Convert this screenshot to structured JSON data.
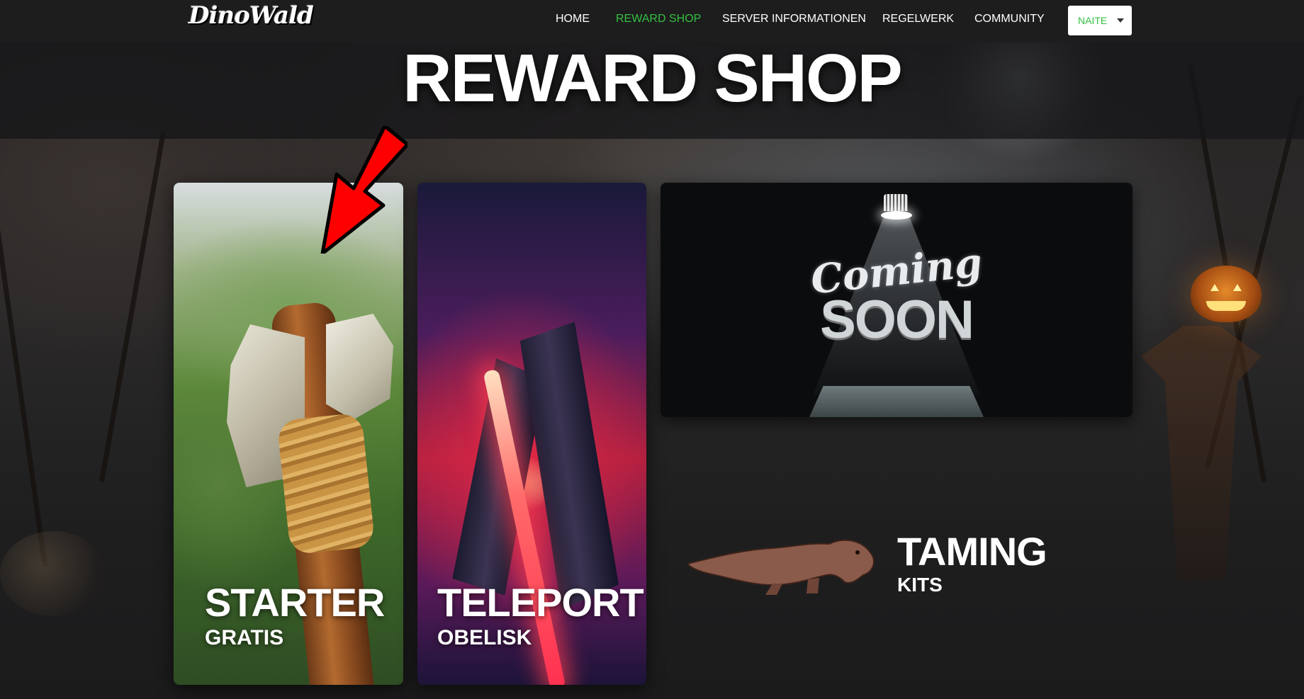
{
  "nav": {
    "logo": "DinoWald",
    "items": [
      {
        "label": "HOME",
        "active": false
      },
      {
        "label": "REWARD SHOP",
        "active": true
      },
      {
        "label": "SERVER INFORMATIONEN",
        "active": false
      },
      {
        "label": "REGELWERK",
        "active": false
      },
      {
        "label": "COMMUNITY",
        "active": false
      }
    ],
    "user": "NAITE",
    "active_color": "#34c141"
  },
  "page": {
    "title": "REWARD SHOP"
  },
  "cards": {
    "starter": {
      "title": "STARTER",
      "subtitle": "GRATIS"
    },
    "teleport": {
      "title": "TELEPORT",
      "subtitle": "OBELISK"
    },
    "coming": {
      "script": "Coming",
      "main": "SOON"
    },
    "taming": {
      "title": "TAMING",
      "subtitle": "KITS"
    }
  },
  "icons": {
    "arrow": "red-arrow-pointer",
    "dropdown": "caret-down-icon"
  }
}
